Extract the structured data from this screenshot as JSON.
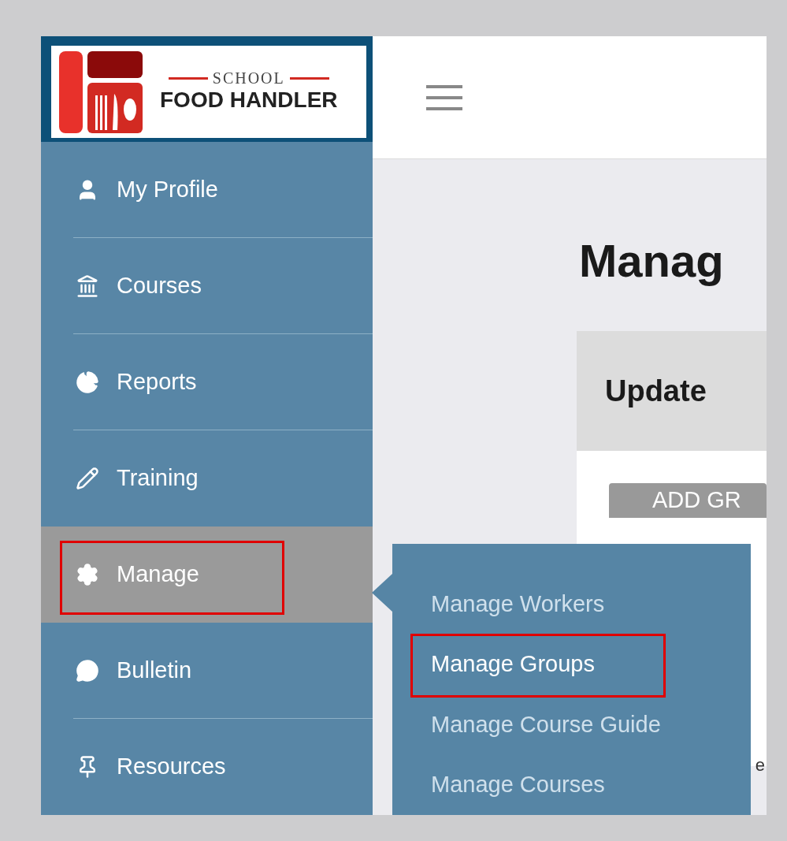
{
  "logo": {
    "line_1": "SCHOOL",
    "line_2": "FOOD HANDLER"
  },
  "sidebar": {
    "items": [
      {
        "label": "My Profile",
        "selected": false,
        "annotated": false
      },
      {
        "label": "Courses",
        "selected": false,
        "annotated": false
      },
      {
        "label": "Reports",
        "selected": false,
        "annotated": false
      },
      {
        "label": "Training",
        "selected": false,
        "annotated": false
      },
      {
        "label": "Manage",
        "selected": true,
        "annotated": true
      },
      {
        "label": "Bulletin",
        "selected": false,
        "annotated": false
      },
      {
        "label": "Resources",
        "selected": false,
        "annotated": false
      }
    ]
  },
  "submenu": {
    "items": [
      {
        "label": "Manage Workers",
        "selected": false,
        "annotated": false
      },
      {
        "label": "Manage Groups",
        "selected": true,
        "annotated": true
      },
      {
        "label": "Manage Course Guide",
        "selected": false,
        "annotated": false
      },
      {
        "label": "Manage Courses",
        "selected": false,
        "annotated": false
      }
    ]
  },
  "main": {
    "title": "Manag",
    "panel_title": "Update",
    "button": "ADD GR",
    "partial_text": "e"
  }
}
